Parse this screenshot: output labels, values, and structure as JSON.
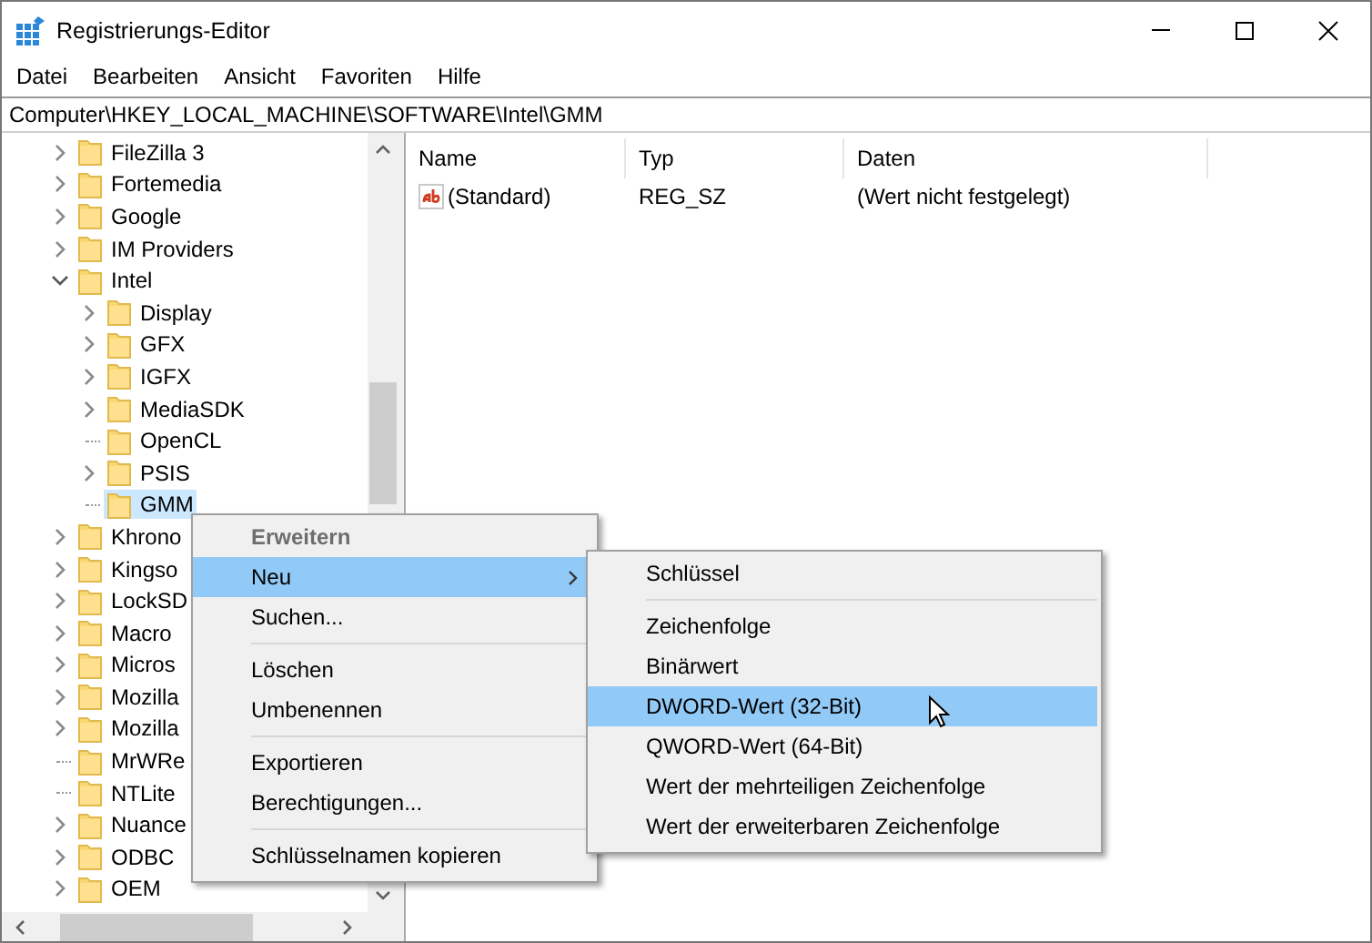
{
  "window": {
    "title": "Registrierungs-Editor"
  },
  "menu_bar": [
    "Datei",
    "Bearbeiten",
    "Ansicht",
    "Favoriten",
    "Hilfe"
  ],
  "address": "Computer\\HKEY_LOCAL_MACHINE\\SOFTWARE\\Intel\\GMM",
  "tree": [
    {
      "label": "FileZilla 3",
      "expandable": true,
      "expanded": false,
      "selected": false
    },
    {
      "label": "Fortemedia",
      "expandable": true,
      "expanded": false,
      "selected": false
    },
    {
      "label": "Google",
      "expandable": true,
      "expanded": false,
      "selected": false
    },
    {
      "label": "IM Providers",
      "expandable": true,
      "expanded": false,
      "selected": false
    },
    {
      "label": "Intel",
      "expandable": true,
      "expanded": true,
      "selected": false,
      "children": [
        {
          "label": "Display",
          "expandable": true,
          "expanded": false,
          "selected": false
        },
        {
          "label": "GFX",
          "expandable": true,
          "expanded": false,
          "selected": false
        },
        {
          "label": "IGFX",
          "expandable": true,
          "expanded": false,
          "selected": false
        },
        {
          "label": "MediaSDK",
          "expandable": true,
          "expanded": false,
          "selected": false
        },
        {
          "label": "OpenCL",
          "expandable": false,
          "selected": false
        },
        {
          "label": "PSIS",
          "expandable": true,
          "expanded": false,
          "selected": false
        },
        {
          "label": "GMM",
          "expandable": false,
          "selected": true
        }
      ]
    },
    {
      "label": "Khrono",
      "expandable": true,
      "expanded": false,
      "selected": false
    },
    {
      "label": "Kingso",
      "expandable": true,
      "expanded": false,
      "selected": false
    },
    {
      "label": "LockSD",
      "expandable": true,
      "expanded": false,
      "selected": false
    },
    {
      "label": "Macro",
      "expandable": true,
      "expanded": false,
      "selected": false
    },
    {
      "label": "Micros",
      "expandable": true,
      "expanded": false,
      "selected": false
    },
    {
      "label": "Mozilla",
      "expandable": true,
      "expanded": false,
      "selected": false
    },
    {
      "label": "Mozilla",
      "expandable": true,
      "expanded": false,
      "selected": false
    },
    {
      "label": "MrWRe",
      "expandable": false,
      "selected": false
    },
    {
      "label": "NTLite",
      "expandable": false,
      "selected": false
    },
    {
      "label": "Nuance",
      "expandable": true,
      "expanded": false,
      "selected": false
    },
    {
      "label": "ODBC",
      "expandable": true,
      "expanded": false,
      "selected": false
    },
    {
      "label": "OEM",
      "expandable": true,
      "expanded": false,
      "selected": false
    }
  ],
  "list": {
    "columns": [
      "Name",
      "Typ",
      "Daten"
    ],
    "rows": [
      {
        "name": "(Standard)",
        "type": "REG_SZ",
        "data": "(Wert nicht festgelegt)"
      }
    ]
  },
  "context_menu": {
    "items": [
      {
        "kind": "default",
        "label": "Erweitern",
        "selected": false
      },
      {
        "kind": "submenu",
        "label": "Neu",
        "selected": true
      },
      {
        "kind": "item",
        "label": "Suchen...",
        "selected": false
      },
      {
        "kind": "separator"
      },
      {
        "kind": "item",
        "label": "Löschen",
        "selected": false
      },
      {
        "kind": "item",
        "label": "Umbenennen",
        "selected": false
      },
      {
        "kind": "separator"
      },
      {
        "kind": "item",
        "label": "Exportieren",
        "selected": false
      },
      {
        "kind": "item",
        "label": "Berechtigungen...",
        "selected": false
      },
      {
        "kind": "separator"
      },
      {
        "kind": "item",
        "label": "Schlüsselnamen kopieren",
        "selected": false
      }
    ]
  },
  "submenu": {
    "items": [
      {
        "kind": "item",
        "label": "Schlüssel",
        "selected": false
      },
      {
        "kind": "separator"
      },
      {
        "kind": "item",
        "label": "Zeichenfolge",
        "selected": false
      },
      {
        "kind": "item",
        "label": "Binärwert",
        "selected": false
      },
      {
        "kind": "item",
        "label": "DWORD-Wert (32-Bit)",
        "selected": true
      },
      {
        "kind": "item",
        "label": "QWORD-Wert (64-Bit)",
        "selected": false
      },
      {
        "kind": "item",
        "label": "Wert der mehrteiligen Zeichenfolge",
        "selected": false
      },
      {
        "kind": "item",
        "label": "Wert der erweiterbaren Zeichenfolge",
        "selected": false
      }
    ]
  }
}
